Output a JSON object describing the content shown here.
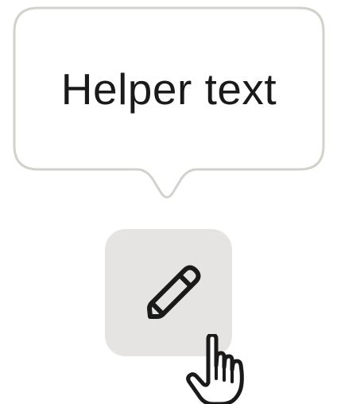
{
  "tooltip": {
    "text": "Helper text"
  },
  "edit_button": {
    "icon": "pencil-icon"
  },
  "cursor": {
    "icon": "hand-pointer-icon"
  },
  "colors": {
    "tooltip_border": "#d2d2cc",
    "tooltip_bg": "#ffffff",
    "button_bg": "#e5e4e2",
    "icon_stroke": "#1a1a1a"
  }
}
